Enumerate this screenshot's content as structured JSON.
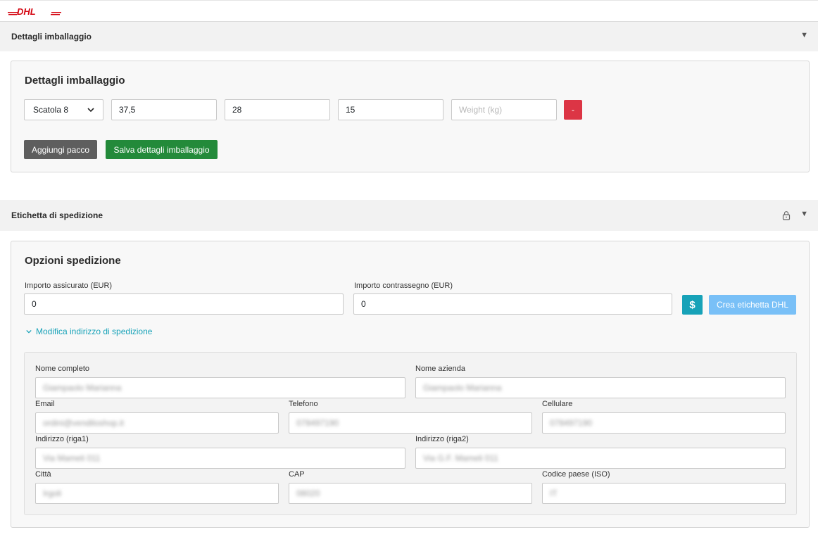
{
  "brand": {
    "logo_text": "DHL",
    "logo_color": "#d40511"
  },
  "packaging_section": {
    "header_title": "Dettagli imballaggio",
    "card_title": "Dettagli imballaggio",
    "box_select": "Scatola 8",
    "length": "37,5",
    "width": "28",
    "height": "15",
    "weight_placeholder": "Weight (kg)",
    "remove_label": "-",
    "add_package_label": "Aggiungi pacco",
    "save_label": "Salva dettagli imballaggio"
  },
  "shipping_section": {
    "header_title": "Etichetta di spedizione",
    "card_title": "Opzioni spedizione",
    "insured_label": "Importo assicurato (EUR)",
    "insured_value": "0",
    "cod_label": "Importo contrassegno (EUR)",
    "cod_value": "0",
    "currency_button_label": "$",
    "create_label_button": "Crea etichetta DHL",
    "edit_address_link": "Modifica indirizzo di spedizione",
    "address": {
      "full_name_label": "Nome completo",
      "full_name_value": "Giampaolo Marianna",
      "company_label": "Nome azienda",
      "company_value": "Giampaolo Marianna",
      "email_label": "Email",
      "email_value": "ordini@vendiloshop.it",
      "phone_label": "Telefono",
      "phone_value": "078497190",
      "mobile_label": "Cellulare",
      "mobile_value": "078497190",
      "address1_label": "Indirizzo (riga1)",
      "address1_value": "Via Mameli 011",
      "address2_label": "Indirizzo (riga2)",
      "address2_value": "Via G.F. Mameli 011",
      "city_label": "Città",
      "city_value": "Irgoli",
      "zip_label": "CAP",
      "zip_value": "08020",
      "country_label": "Codice paese (ISO)",
      "country_value": "IT"
    }
  },
  "colors": {
    "green": "#238a3a",
    "red": "#dc3545",
    "teal": "#17a2b8",
    "light_blue": "#79c0f7",
    "gray_button": "#5e5e5e"
  }
}
